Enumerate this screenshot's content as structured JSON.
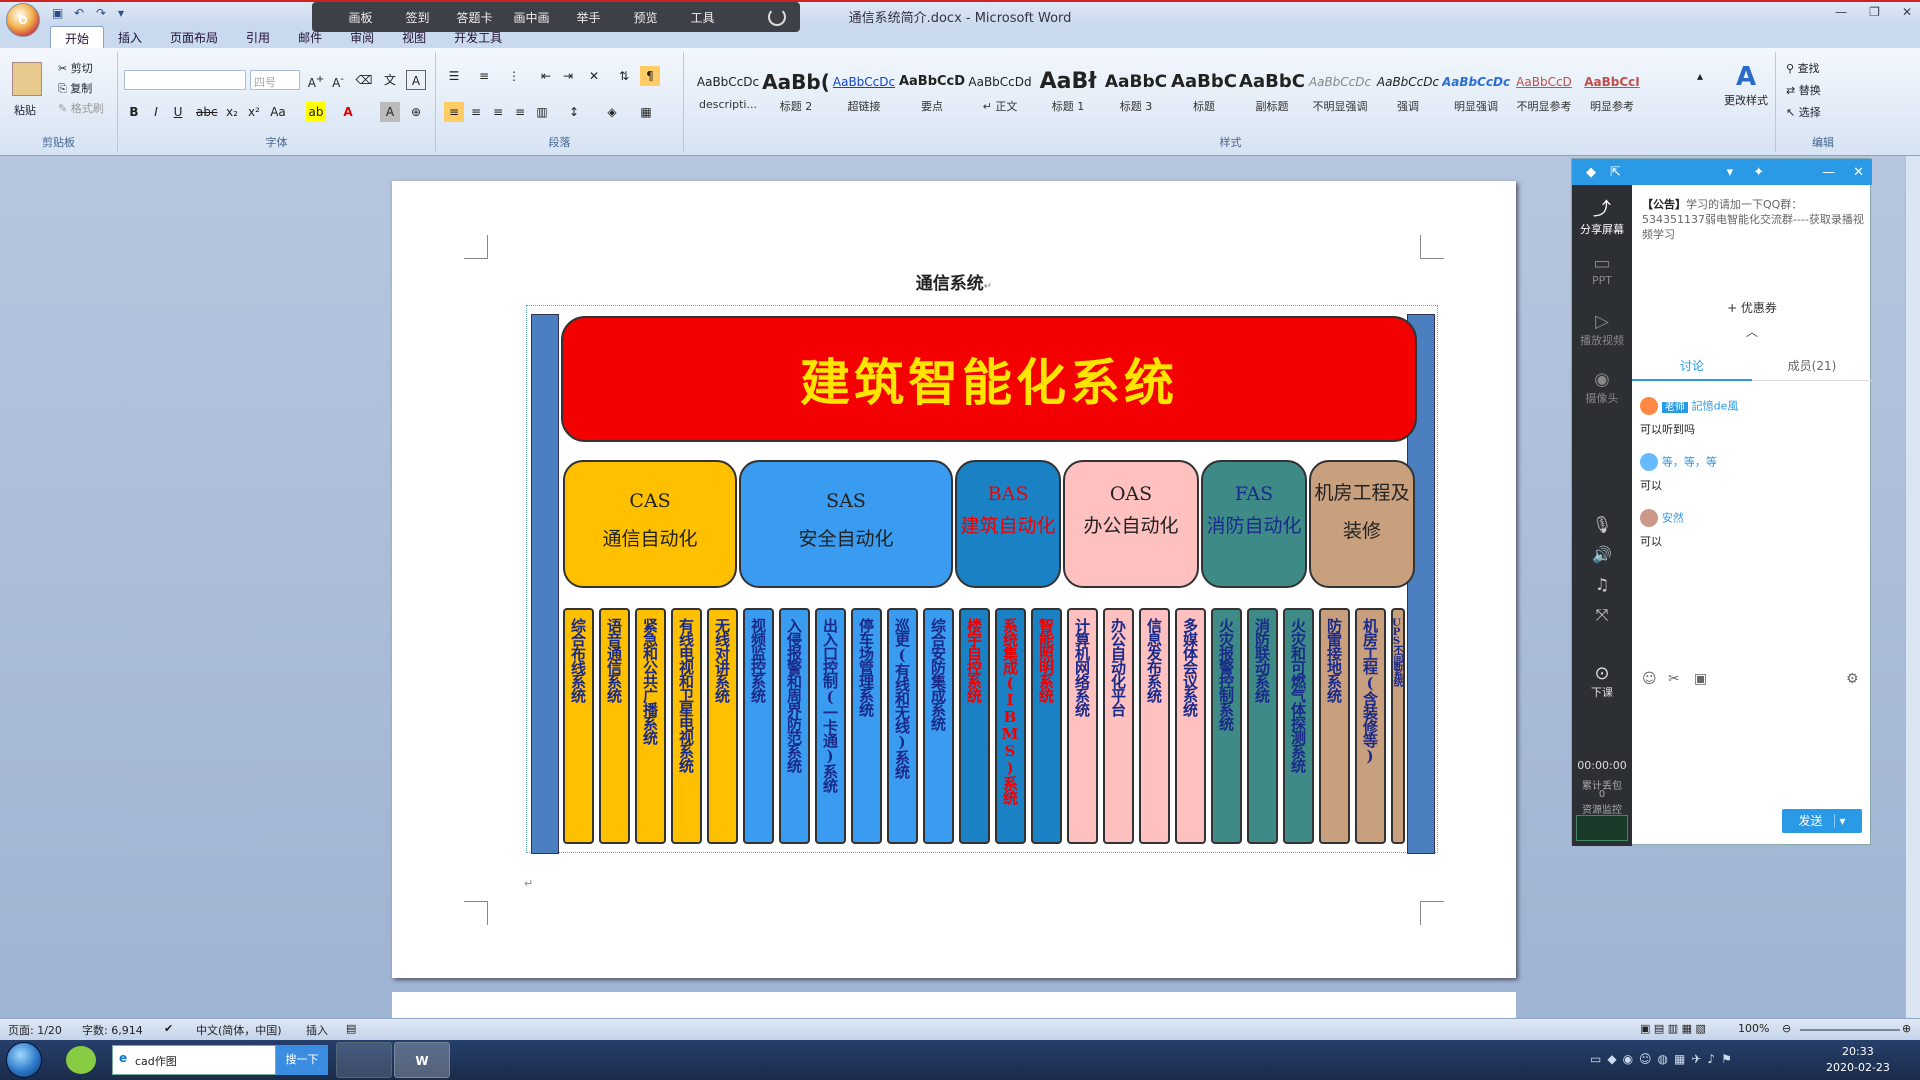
{
  "window": {
    "title": "通信系统简介.docx - Microsoft Word"
  },
  "orb": "O",
  "class_toolbar": {
    "items": [
      "画板",
      "签到",
      "答题卡",
      "画中画",
      "举手",
      "预览",
      "工具"
    ]
  },
  "tabs": [
    "开始",
    "插入",
    "页面布局",
    "引用",
    "邮件",
    "审阅",
    "视图",
    "开发工具"
  ],
  "clipboard": {
    "paste": "粘贴",
    "cut": "剪切",
    "copy": "复制",
    "painter": "格式刷",
    "group": "剪贴板"
  },
  "font": {
    "size_placeholder": "四号",
    "group": "字体"
  },
  "paragraph": {
    "group": "段落"
  },
  "styles": {
    "group": "样式",
    "change": "更改样式",
    "items": [
      {
        "preview": "AaBbCcDc",
        "name": "descripti..."
      },
      {
        "preview": "AaBb(",
        "name": "标题 2"
      },
      {
        "preview": "AaBbCcDc",
        "name": "超链接"
      },
      {
        "preview": "AaBbCcD",
        "name": "要点"
      },
      {
        "preview": "AaBbCcDd",
        "name": "↵ 正文"
      },
      {
        "preview": "AaBł",
        "name": "标题 1"
      },
      {
        "preview": "AaBbC",
        "name": "标题 3"
      },
      {
        "preview": "AaBbC",
        "name": "标题"
      },
      {
        "preview": "AaBbC",
        "name": "副标题"
      },
      {
        "preview": "AaBbCcDc",
        "name": "不明显强调"
      },
      {
        "preview": "AaBbCcDc",
        "name": "强调"
      },
      {
        "preview": "AaBbCcDc",
        "name": "明显强调"
      },
      {
        "preview": "AaBbCcD",
        "name": "不明显参考"
      },
      {
        "preview": "AaBbCcI",
        "name": "明显参考"
      }
    ]
  },
  "editing": {
    "group": "编辑",
    "find": "查找",
    "replace": "替换",
    "select": "选择"
  },
  "document": {
    "title": "通信系统",
    "title_mark": "↵",
    "end_mark": "↵",
    "main_box": "建筑智能化系统",
    "categories": [
      {
        "line1": "CAS",
        "line2": "通信自动化"
      },
      {
        "line1": "SAS",
        "line2": "安全自动化"
      },
      {
        "line1": "BAS",
        "line2": "建筑自动化"
      },
      {
        "line1": "OAS",
        "line2": "办公自动化"
      },
      {
        "line1": "FAS",
        "line2": "消防自动化"
      },
      {
        "line1": "",
        "line2": "机房工程及装修"
      }
    ],
    "subsystems": [
      "综合布线系统",
      "语音通信系统",
      "紧急和公共广播系统",
      "有线电视和卫星电视系统",
      "无线对讲系统",
      "视频监控系统",
      "入侵报警和周界防范系统",
      "出入口控制(一卡通)系统",
      "停车场管理系统",
      "巡更(有线和无线)系统",
      "综合安防集成系统",
      "楼宇自控系统",
      "系统集成(IBMS)系统",
      "智能照明系统",
      "计算机网络系统",
      "办公自动化平台",
      "信息发布系统",
      "多媒体会议系统",
      "火灾报警控制系统",
      "消防联动系统",
      "火灾和可燃气体探测系统",
      "防雷接地系统",
      "机房工程(含装修等)",
      "UPS不间断系统"
    ]
  },
  "chat": {
    "side": {
      "share": "分享屏幕",
      "ppt": "PPT",
      "video": "播放视频",
      "camera": "摄像头",
      "end": "下课",
      "time": "00:00:00",
      "packet_loss": "累计丢包",
      "packet_value": "0",
      "resource": "资源监控"
    },
    "announcement_tag": "【公告】",
    "announcement": "学习的请加一下QQ群：534351137弱电智能化交流群----获取录播视频学习",
    "coupon": "+ 优惠券",
    "tab_discuss": "讨论",
    "tab_members": "成员(21)",
    "messages": [
      {
        "badge": "老师",
        "user": "記憶de風",
        "text": "可以听到吗"
      },
      {
        "badge": "",
        "user": "等，等，等",
        "text": "可以"
      },
      {
        "badge": "",
        "user": "安然",
        "text": "可以"
      }
    ],
    "send": "发送"
  },
  "status": {
    "page": "页面: 1/20",
    "words": "字数: 6,914",
    "lang": "中文(简体，中国)",
    "mode": "插入",
    "zoom": "100%"
  },
  "taskbar": {
    "ie_text": "cad作图",
    "search": "搜一下",
    "time": "20:33",
    "date": "2020-02-23"
  }
}
